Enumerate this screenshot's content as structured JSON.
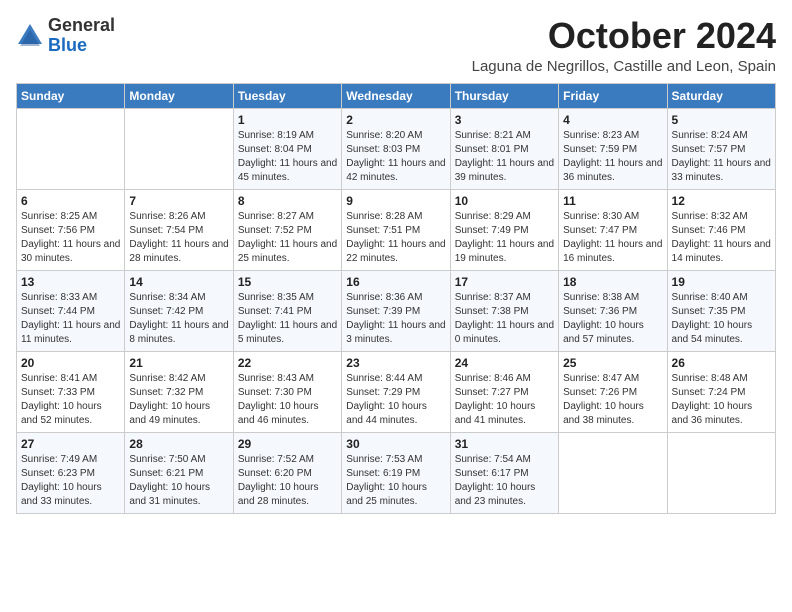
{
  "logo": {
    "general": "General",
    "blue": "Blue"
  },
  "title": "October 2024",
  "location": "Laguna de Negrillos, Castille and Leon, Spain",
  "days_of_week": [
    "Sunday",
    "Monday",
    "Tuesday",
    "Wednesday",
    "Thursday",
    "Friday",
    "Saturday"
  ],
  "weeks": [
    [
      {
        "day": "",
        "sunrise": "",
        "sunset": "",
        "daylight": ""
      },
      {
        "day": "",
        "sunrise": "",
        "sunset": "",
        "daylight": ""
      },
      {
        "day": "1",
        "sunrise": "Sunrise: 8:19 AM",
        "sunset": "Sunset: 8:04 PM",
        "daylight": "Daylight: 11 hours and 45 minutes."
      },
      {
        "day": "2",
        "sunrise": "Sunrise: 8:20 AM",
        "sunset": "Sunset: 8:03 PM",
        "daylight": "Daylight: 11 hours and 42 minutes."
      },
      {
        "day": "3",
        "sunrise": "Sunrise: 8:21 AM",
        "sunset": "Sunset: 8:01 PM",
        "daylight": "Daylight: 11 hours and 39 minutes."
      },
      {
        "day": "4",
        "sunrise": "Sunrise: 8:23 AM",
        "sunset": "Sunset: 7:59 PM",
        "daylight": "Daylight: 11 hours and 36 minutes."
      },
      {
        "day": "5",
        "sunrise": "Sunrise: 8:24 AM",
        "sunset": "Sunset: 7:57 PM",
        "daylight": "Daylight: 11 hours and 33 minutes."
      }
    ],
    [
      {
        "day": "6",
        "sunrise": "Sunrise: 8:25 AM",
        "sunset": "Sunset: 7:56 PM",
        "daylight": "Daylight: 11 hours and 30 minutes."
      },
      {
        "day": "7",
        "sunrise": "Sunrise: 8:26 AM",
        "sunset": "Sunset: 7:54 PM",
        "daylight": "Daylight: 11 hours and 28 minutes."
      },
      {
        "day": "8",
        "sunrise": "Sunrise: 8:27 AM",
        "sunset": "Sunset: 7:52 PM",
        "daylight": "Daylight: 11 hours and 25 minutes."
      },
      {
        "day": "9",
        "sunrise": "Sunrise: 8:28 AM",
        "sunset": "Sunset: 7:51 PM",
        "daylight": "Daylight: 11 hours and 22 minutes."
      },
      {
        "day": "10",
        "sunrise": "Sunrise: 8:29 AM",
        "sunset": "Sunset: 7:49 PM",
        "daylight": "Daylight: 11 hours and 19 minutes."
      },
      {
        "day": "11",
        "sunrise": "Sunrise: 8:30 AM",
        "sunset": "Sunset: 7:47 PM",
        "daylight": "Daylight: 11 hours and 16 minutes."
      },
      {
        "day": "12",
        "sunrise": "Sunrise: 8:32 AM",
        "sunset": "Sunset: 7:46 PM",
        "daylight": "Daylight: 11 hours and 14 minutes."
      }
    ],
    [
      {
        "day": "13",
        "sunrise": "Sunrise: 8:33 AM",
        "sunset": "Sunset: 7:44 PM",
        "daylight": "Daylight: 11 hours and 11 minutes."
      },
      {
        "day": "14",
        "sunrise": "Sunrise: 8:34 AM",
        "sunset": "Sunset: 7:42 PM",
        "daylight": "Daylight: 11 hours and 8 minutes."
      },
      {
        "day": "15",
        "sunrise": "Sunrise: 8:35 AM",
        "sunset": "Sunset: 7:41 PM",
        "daylight": "Daylight: 11 hours and 5 minutes."
      },
      {
        "day": "16",
        "sunrise": "Sunrise: 8:36 AM",
        "sunset": "Sunset: 7:39 PM",
        "daylight": "Daylight: 11 hours and 3 minutes."
      },
      {
        "day": "17",
        "sunrise": "Sunrise: 8:37 AM",
        "sunset": "Sunset: 7:38 PM",
        "daylight": "Daylight: 11 hours and 0 minutes."
      },
      {
        "day": "18",
        "sunrise": "Sunrise: 8:38 AM",
        "sunset": "Sunset: 7:36 PM",
        "daylight": "Daylight: 10 hours and 57 minutes."
      },
      {
        "day": "19",
        "sunrise": "Sunrise: 8:40 AM",
        "sunset": "Sunset: 7:35 PM",
        "daylight": "Daylight: 10 hours and 54 minutes."
      }
    ],
    [
      {
        "day": "20",
        "sunrise": "Sunrise: 8:41 AM",
        "sunset": "Sunset: 7:33 PM",
        "daylight": "Daylight: 10 hours and 52 minutes."
      },
      {
        "day": "21",
        "sunrise": "Sunrise: 8:42 AM",
        "sunset": "Sunset: 7:32 PM",
        "daylight": "Daylight: 10 hours and 49 minutes."
      },
      {
        "day": "22",
        "sunrise": "Sunrise: 8:43 AM",
        "sunset": "Sunset: 7:30 PM",
        "daylight": "Daylight: 10 hours and 46 minutes."
      },
      {
        "day": "23",
        "sunrise": "Sunrise: 8:44 AM",
        "sunset": "Sunset: 7:29 PM",
        "daylight": "Daylight: 10 hours and 44 minutes."
      },
      {
        "day": "24",
        "sunrise": "Sunrise: 8:46 AM",
        "sunset": "Sunset: 7:27 PM",
        "daylight": "Daylight: 10 hours and 41 minutes."
      },
      {
        "day": "25",
        "sunrise": "Sunrise: 8:47 AM",
        "sunset": "Sunset: 7:26 PM",
        "daylight": "Daylight: 10 hours and 38 minutes."
      },
      {
        "day": "26",
        "sunrise": "Sunrise: 8:48 AM",
        "sunset": "Sunset: 7:24 PM",
        "daylight": "Daylight: 10 hours and 36 minutes."
      }
    ],
    [
      {
        "day": "27",
        "sunrise": "Sunrise: 7:49 AM",
        "sunset": "Sunset: 6:23 PM",
        "daylight": "Daylight: 10 hours and 33 minutes."
      },
      {
        "day": "28",
        "sunrise": "Sunrise: 7:50 AM",
        "sunset": "Sunset: 6:21 PM",
        "daylight": "Daylight: 10 hours and 31 minutes."
      },
      {
        "day": "29",
        "sunrise": "Sunrise: 7:52 AM",
        "sunset": "Sunset: 6:20 PM",
        "daylight": "Daylight: 10 hours and 28 minutes."
      },
      {
        "day": "30",
        "sunrise": "Sunrise: 7:53 AM",
        "sunset": "Sunset: 6:19 PM",
        "daylight": "Daylight: 10 hours and 25 minutes."
      },
      {
        "day": "31",
        "sunrise": "Sunrise: 7:54 AM",
        "sunset": "Sunset: 6:17 PM",
        "daylight": "Daylight: 10 hours and 23 minutes."
      },
      {
        "day": "",
        "sunrise": "",
        "sunset": "",
        "daylight": ""
      },
      {
        "day": "",
        "sunrise": "",
        "sunset": "",
        "daylight": ""
      }
    ]
  ]
}
